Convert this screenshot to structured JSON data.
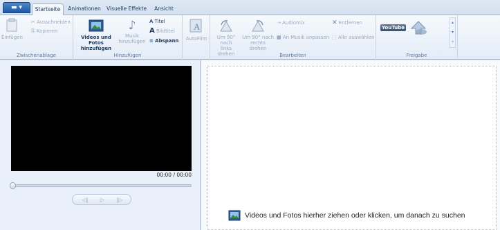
{
  "tabs": [
    {
      "label": "Startseite",
      "active": true
    },
    {
      "label": "Animationen",
      "active": false
    },
    {
      "label": "Visuelle Effekte",
      "active": false
    },
    {
      "label": "Ansicht",
      "active": false
    }
  ],
  "ribbon": {
    "clipboard": {
      "label": "Zwischenablage",
      "paste": "Einfügen",
      "cut": "Ausschneiden",
      "copy": "Kopieren"
    },
    "add": {
      "label": "Hinzufügen",
      "videos_line1": "Videos und Fotos",
      "videos_line2": "hinzufügen",
      "music_line1": "Musik",
      "music_line2": "hinzufügen",
      "title": "Titel",
      "caption": "Bildtitel",
      "credits": "Abspann"
    },
    "autofilm": "AutoFilm",
    "edit": {
      "label": "Bearbeiten",
      "rotate_left_1": "Um 90° nach",
      "rotate_left_2": "links drehen",
      "rotate_right_1": "Um 90° nach",
      "rotate_right_2": "rechts drehen",
      "audiomix": "Audiomix",
      "fit_music": "An Musik anpassen",
      "remove": "Entfernen",
      "select_all": "Alle auswählen"
    },
    "share": {
      "label": "Freigabe",
      "youtube": "YouTube"
    }
  },
  "player": {
    "time": "00:00 / 00:00",
    "progress": 0
  },
  "storyboard": {
    "hint": "Videos und Fotos hierher ziehen oder klicken, um danach zu suchen"
  },
  "colors": {
    "ribbon_bg": "#e4ecf7",
    "pane_bg": "#e9f0f9",
    "accent": "#1d5aa6"
  }
}
